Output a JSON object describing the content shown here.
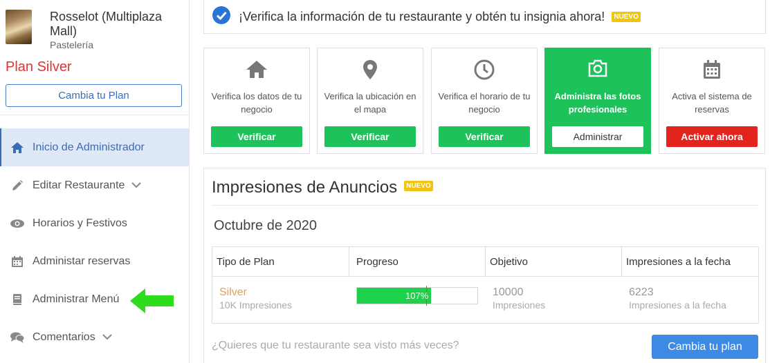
{
  "profile": {
    "name": "Rosselot (Multiplaza Mall)",
    "category": "Pastelería",
    "plan": "Plan Silver",
    "change_plan_label": "Cambia tu Plan"
  },
  "nav": {
    "items": [
      {
        "label": "Inicio de Administrador",
        "icon": "home-icon",
        "active": true
      },
      {
        "label": "Editar Restaurante",
        "icon": "pencil-icon",
        "has_chevron": true
      },
      {
        "label": "Horarios y Festivos",
        "icon": "eye-icon"
      },
      {
        "label": "Administar reservas",
        "icon": "calendar-icon"
      },
      {
        "label": "Administrar Menú",
        "icon": "book-icon"
      },
      {
        "label": "Comentarios",
        "icon": "comments-icon",
        "has_chevron": true
      }
    ]
  },
  "banner": {
    "text": "¡Verifica la información de tu restaurante y obtén tu insignia ahora!",
    "badge": "NUEVO"
  },
  "cards": [
    {
      "text": "Verifica los datos de tu negocio",
      "button": "Verificar",
      "icon": "home-icon"
    },
    {
      "text": "Verifica la ubicación en el mapa",
      "button": "Verificar",
      "icon": "map-pin-icon"
    },
    {
      "text": "Verifica el horario de tu negocio",
      "button": "Verificar",
      "icon": "clock-icon"
    },
    {
      "text": "Administra las fotos profesionales",
      "button": "Administrar",
      "icon": "camera-icon"
    },
    {
      "text": "Activa el sistema de reservas",
      "button": "Activar ahora",
      "icon": "calendar-icon"
    }
  ],
  "impressions": {
    "title": "Impresiones de Anuncios",
    "badge": "NUEVO",
    "month": "Octubre de 2020",
    "headers": [
      "Tipo de Plan",
      "Progreso",
      "Objetivo",
      "Impresiones a la fecha"
    ],
    "row": {
      "plan": "Silver",
      "plan_sub": "10K Impresiones",
      "progress_text": "107%",
      "progress_fraction": 1.07,
      "goal": "10000",
      "goal_sub": "Impresiones",
      "current": "6223",
      "current_sub": "Impresiones a la fecha"
    },
    "question": "¿Quieres que tu restaurante sea visto más veces?",
    "change_plan_label": "Cambia tu plan"
  },
  "colors": {
    "green": "#1ec25a",
    "red": "#e3241e",
    "blue": "#3d8ae5",
    "plan_red": "#e03232",
    "badge_yellow": "#f1c40f"
  }
}
